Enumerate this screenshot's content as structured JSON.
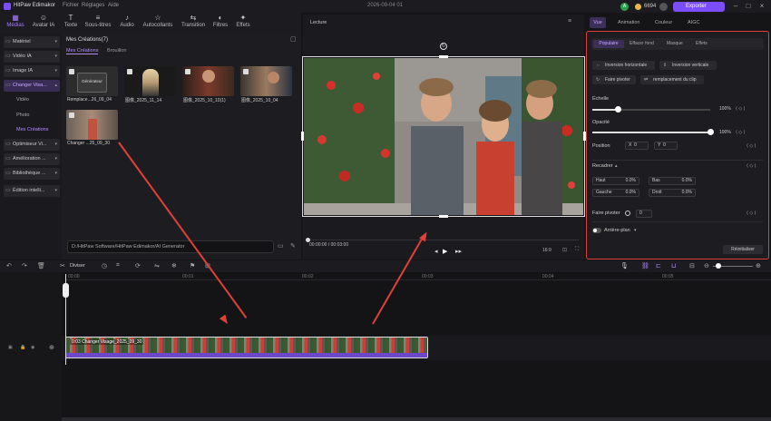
{
  "titlebar": {
    "app": "HitPaw Edimakor",
    "menu": [
      "Fichier",
      "Réglages",
      "Aide"
    ],
    "date": "2026-09-04 01",
    "credits": "6694",
    "export": "Exporter"
  },
  "toolbar": [
    "Médias",
    "Avatar IA",
    "Texte",
    "Sous-titres",
    "Audio",
    "Autocollants",
    "Transition",
    "Filtres",
    "Effets"
  ],
  "sidebar": {
    "items": [
      "Matériel",
      "Vidéo IA",
      "Image IA",
      "Changer Visa..."
    ],
    "sub": [
      "Vidéo",
      "Photo",
      "Mes Créations"
    ],
    "more": [
      "Optimiseur Vi...",
      "Amélioration ...",
      "Bibliothèque ...",
      "Édition intelli..."
    ]
  },
  "media": {
    "heading": "Mes Créations(7)",
    "tabs": [
      "Mes Créations",
      "Brouillon"
    ],
    "thumbs": [
      "Remplace...26_09_04",
      "图像_2025_11_14",
      "图像_2025_10_10(1)",
      "图像_2025_10_04",
      "Changer ...25_09_30"
    ],
    "thumb_text": "Générateur",
    "path": "D:/HitPaw Software/HitPaw Edimakor/AI Generator"
  },
  "preview": {
    "title": "Lecture",
    "time": "00:00:00 / 00:03:00",
    "ratio": "16:9"
  },
  "inspector": {
    "tabs": [
      "Vue",
      "Animation",
      "Couleur",
      "AIGC"
    ],
    "subtabs": [
      "Populaire",
      "Effacer fond",
      "Masque",
      "Effets"
    ],
    "buttons": [
      "Inversion horizontale",
      "Inversion verticale",
      "Faire pivoter",
      "remplacement du clip"
    ],
    "echelle": "Échelle",
    "echelle_val": "100%",
    "opacite": "Opacité",
    "opacite_val": "100%",
    "position": "Position",
    "x": "X",
    "xval": "0",
    "y": "Y",
    "yval": "0",
    "recadrer": "Recadrer",
    "haut": "Haut",
    "haut_v": "0.0%",
    "bas": "Bas",
    "bas_v": "0.0%",
    "gauche": "Gauche",
    "gauche_v": "0.0%",
    "droit": "Droit",
    "droit_v": "0.0%",
    "pivoter": "Faire pivoter",
    "pivoter_v": "0",
    "arriere": "Arrière-plan",
    "reset": "Réinitialiser"
  },
  "timeline": {
    "divider": "Diviser",
    "ticks": [
      "00:00",
      "00:01",
      "00:02",
      "00:03",
      "00:04",
      "00:05"
    ],
    "clip": "0:03 Changer Visage_2025_09_30"
  }
}
